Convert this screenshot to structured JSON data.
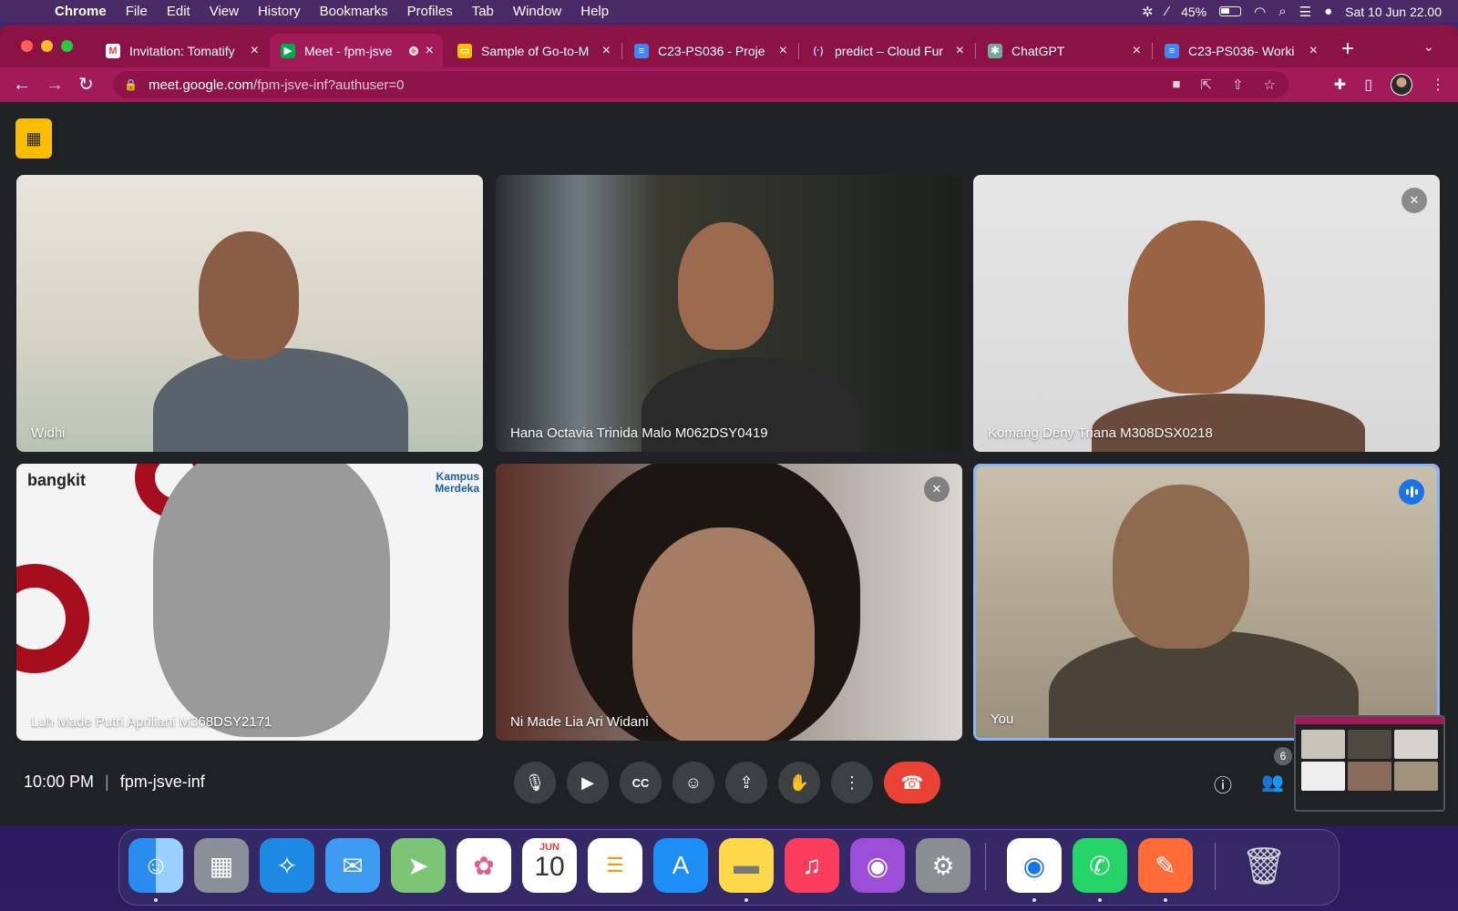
{
  "menubar": {
    "app": "Chrome",
    "items": [
      "File",
      "Edit",
      "View",
      "History",
      "Bookmarks",
      "Profiles",
      "Tab",
      "Window",
      "Help"
    ],
    "battery": "45%",
    "datetime": "Sat 10 Jun  22.00"
  },
  "tabs": [
    {
      "title": "Invitation: Tomatify",
      "icon": "gmail-icon"
    },
    {
      "title": "Meet - fpm-jsve",
      "icon": "meet-icon",
      "active": true
    },
    {
      "title": "Sample of Go-to-M",
      "icon": "slides-icon"
    },
    {
      "title": "C23-PS036 - Proje",
      "icon": "docs-icon"
    },
    {
      "title": "predict – Cloud Fur",
      "icon": "cloud-functions-icon"
    },
    {
      "title": "ChatGPT",
      "icon": "chatgpt-icon"
    },
    {
      "title": "C23-PS036- Worki",
      "icon": "docs-icon"
    }
  ],
  "address": {
    "host": "meet.google.com",
    "path": "/fpm-jsve-inf?authuser=0"
  },
  "participants": [
    {
      "name": "Widhi",
      "muted": false,
      "speaking": false
    },
    {
      "name": "Hana Octavia Trinida Malo M062DSY0419",
      "muted": false,
      "speaking": false
    },
    {
      "name": "Komang Deny Triana M308DSX0218",
      "muted": true,
      "speaking": false
    },
    {
      "name": "Luh Made Putri Apriliani M368DSY2171",
      "muted": false,
      "speaking": false
    },
    {
      "name": "Ni Made Lia Ari Widani",
      "muted": true,
      "speaking": false
    },
    {
      "name": "You",
      "muted": false,
      "speaking": true
    }
  ],
  "tile_texts": {
    "bangkit": "bangkit",
    "kampus": "Kampus Merdeka"
  },
  "bottom": {
    "time": "10:00 PM",
    "meeting_code": "fpm-jsve-inf",
    "participant_count": "6",
    "controls": [
      "microphone-icon",
      "camera-icon",
      "captions-icon",
      "emoji-icon",
      "present-icon",
      "raise-hand-icon",
      "more-options-icon",
      "end-call-icon"
    ]
  },
  "dock": {
    "calendar_month": "JUN",
    "calendar_day": "10",
    "apps": [
      "Finder",
      "Launchpad",
      "Safari",
      "Mail",
      "Maps",
      "Photos",
      "Calendar",
      "Reminders",
      "App Store",
      "Notes",
      "Music",
      "Podcasts",
      "System Settings",
      "Chrome",
      "WhatsApp",
      "Postman",
      "Trash"
    ]
  },
  "colors": {
    "tab_bar": "#8a1245",
    "toolbar": "#a21a58",
    "meet_bg": "#202124",
    "end_call": "#ea4335",
    "speaking_ring": "#8ab4f8"
  }
}
